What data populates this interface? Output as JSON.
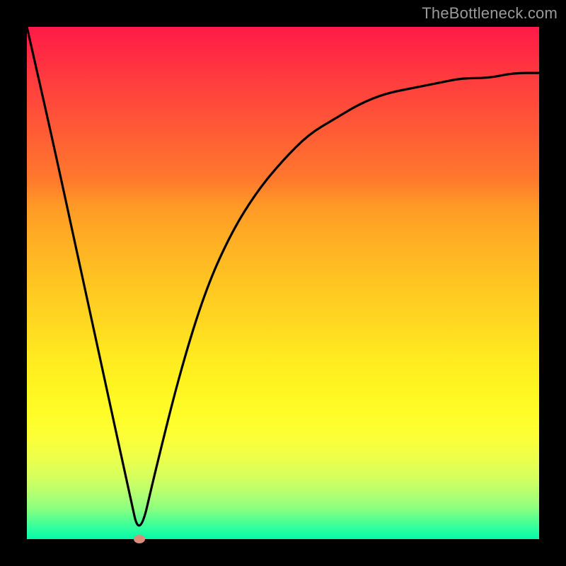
{
  "watermark": "TheBottleneck.com",
  "chart_data": {
    "type": "line",
    "title": "",
    "xlabel": "",
    "ylabel": "",
    "xlim": [
      0,
      100
    ],
    "ylim": [
      0,
      100
    ],
    "x": [
      0,
      5,
      10,
      15,
      20,
      22,
      25,
      30,
      35,
      40,
      45,
      50,
      55,
      60,
      65,
      70,
      75,
      80,
      85,
      90,
      95,
      100
    ],
    "values": [
      100,
      78,
      55,
      32,
      9,
      0,
      13,
      33,
      49,
      60,
      68,
      74,
      79,
      82,
      85,
      87,
      88,
      89,
      90,
      90,
      91,
      91
    ],
    "minimum": {
      "x": 22,
      "y": 0
    },
    "background_gradient_top": "#ff1a47",
    "background_gradient_bottom": "#06f9a8",
    "curve_color": "#000000",
    "dot_color": "#d98d7a"
  }
}
